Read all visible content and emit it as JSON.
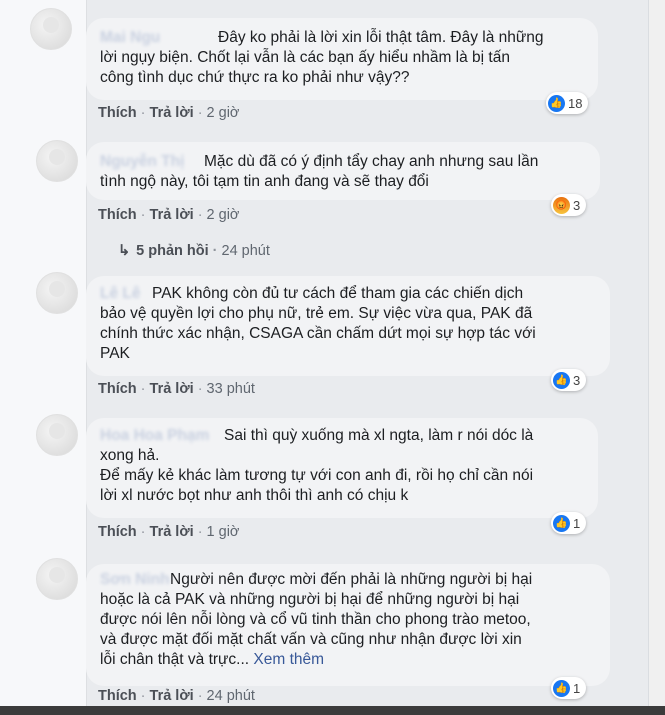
{
  "comments": [
    {
      "author": "Mai Ngu",
      "text": "Đây ko phải là lời xin lỗi thật tâm. Đây là những\nlời ngụy biện. Chốt lại vẫn là các bạn ấy hiểu nhầm là bị tấn\ncông tình dục chứ thực ra ko phải như vậy??",
      "reaction_icon": "like-icon",
      "reaction_count": "18",
      "like_label": "Thích",
      "reply_label": "Trả lời",
      "time": "2 giờ"
    },
    {
      "author": "Nguyễn Thị",
      "text": "Mặc dù đã có ý định tẩy chay anh nhưng sau lần\ntình ngộ này, tôi tạm tin anh đang và sẽ thay đổi",
      "reaction_icon": "angry-icon",
      "reaction_count": "3",
      "like_label": "Thích",
      "reply_label": "Trả lời",
      "time": "2 giờ",
      "replies_label": "5 phản hồi",
      "replies_time": "24 phút"
    },
    {
      "author": "Lê Lê",
      "text": "PAK không còn đủ tư cách để tham gia các chiến dịch\nbảo vệ quyền lợi cho phụ nữ, trẻ em. Sự việc vừa qua, PAK đã\nchính thức xác nhận, CSAGA cần chấm dứt mọi sự hợp tác với\nPAK",
      "reaction_icon": "like-icon",
      "reaction_count": "3",
      "like_label": "Thích",
      "reply_label": "Trả lời",
      "time": "33 phút"
    },
    {
      "author": "Hoa Hoa Phạm",
      "text": "Sai thì quỳ xuống mà xl ngta, làm r nói dóc là\nxong hả.\nĐể mấy kẻ khác làm tương tự với con anh đi, rồi họ chỉ cần nói\nlời xl nước bọt như anh thôi thì anh có chịu k",
      "reaction_icon": "like-icon",
      "reaction_count": "1",
      "like_label": "Thích",
      "reply_label": "Trả lời",
      "time": "1 giờ"
    },
    {
      "author": "Sơn Ninh",
      "text": "Người nên được mời đến phải là những người bị hại\nhoặc là cả PAK và những người bị hại để những người bị hại\nđược nói lên nỗi lòng và cổ vũ tinh thần cho phong trào metoo,\nvà được mặt đối mặt chất vấn và cũng như nhận được lời xin\nlỗi chân thật và trực...",
      "see_more": "Xem thêm",
      "reaction_icon": "like-icon",
      "reaction_count": "1",
      "like_label": "Thích",
      "reply_label": "Trả lời",
      "time": "24 phút"
    }
  ],
  "colors": {
    "link": "#385898",
    "like": "#1877f2",
    "bubble": "#f2f3f5",
    "page": "#e9ebee"
  }
}
